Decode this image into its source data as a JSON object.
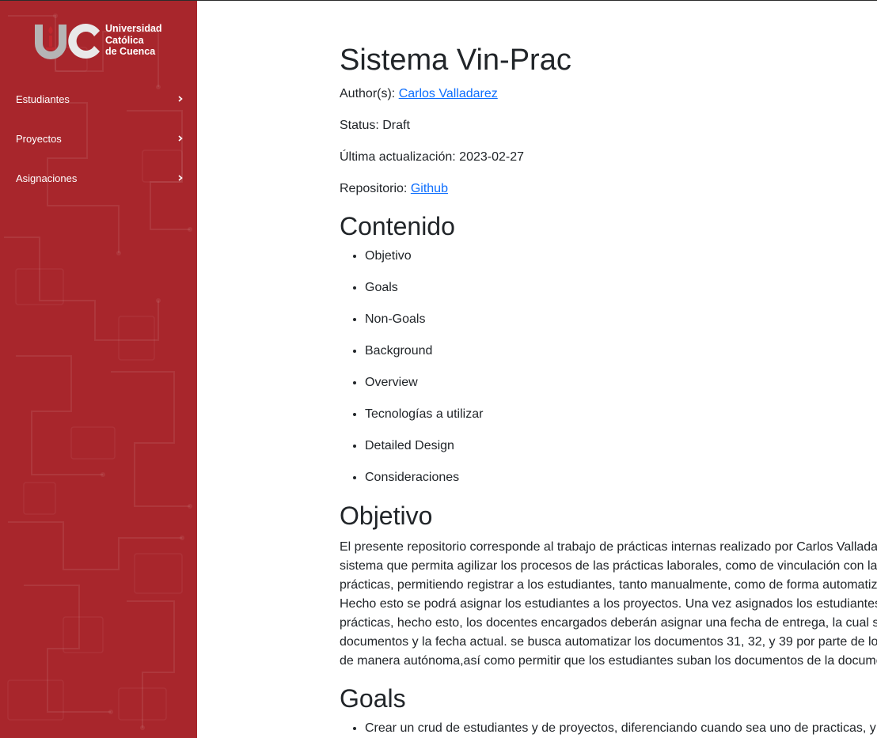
{
  "sidebar": {
    "logo": {
      "letters": "UC",
      "lines": [
        "Universidad",
        "Católica",
        "de Cuenca"
      ]
    },
    "items": [
      {
        "label": "Estudiantes"
      },
      {
        "label": "Proyectos"
      },
      {
        "label": "Asignaciones"
      }
    ]
  },
  "doc": {
    "title": "Sistema Vin-Prac",
    "authors_label": "Author(s): ",
    "authors_link": "Carlos Valladarez",
    "status": "Status: Draft",
    "updated": "Última actualización: 2023-02-27",
    "repo_label": "Repositorio: ",
    "repo_link": "Github",
    "contents_heading": "Contenido",
    "contents": [
      "Objetivo",
      "Goals",
      "Non-Goals",
      "Background",
      "Overview",
      "Tecnologías a utilizar",
      "Detailed Design",
      "Consideraciones"
    ],
    "objective_heading": "Objetivo",
    "objective_lines": [
      "El presente repositorio corresponde al trabajo de prácticas internas realizado por Carlos Vallada",
      "sistema que permita agilizar los procesos de las prácticas laborales, como de vinculación con la",
      "prácticas, permitiendo registrar a los estudiantes, tanto manualmente, como de forma automatiz",
      "Hecho esto se podrá asignar los estudiantes a los proyectos. Una vez asignados los estudiantes",
      "prácticas, hecho esto, los docentes encargados deberán asignar una fecha de entrega, la cual s",
      "documentos y la fecha actual. se busca automatizar los documentos 31, 32, y 39 por parte de lo",
      "de manera autónoma,así como permitir que los estudiantes suban los documentos de la docume"
    ],
    "goals_heading": "Goals",
    "goals": [
      "Crear un crud de estudiantes y de proyectos, diferenciando cuando sea uno de practicas, y"
    ]
  },
  "colors": {
    "sidebar_bg": "#a8262c",
    "link": "#0d6efd",
    "text": "#212529"
  }
}
